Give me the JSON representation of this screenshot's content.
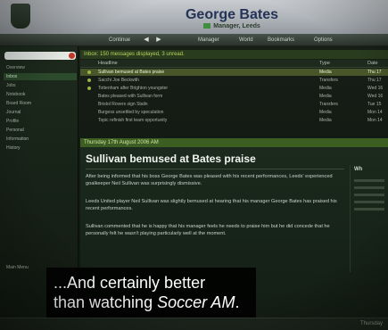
{
  "header": {
    "manager_name": "George Bates",
    "subtitle": "Manager, Leeds"
  },
  "toolbar": {
    "continue_label": "Continue",
    "manager_menu": "Manager",
    "world_menu": "World",
    "bookmarks_menu": "Bookmarks",
    "options_menu": "Options"
  },
  "sidebar": {
    "items": [
      {
        "label": "Overview"
      },
      {
        "label": "Inbox"
      },
      {
        "label": "Jobs"
      },
      {
        "label": "Notebook"
      },
      {
        "label": "Board Room"
      },
      {
        "label": "Journal"
      },
      {
        "label": "Profile"
      },
      {
        "label": "Personal"
      },
      {
        "label": "Information"
      },
      {
        "label": "History"
      }
    ],
    "bottom_label": "Main Menu"
  },
  "inbox": {
    "summary": "Inbox: 150 messages displayed, 3 unread.",
    "columns": [
      "Headline",
      "Type",
      "Date"
    ],
    "rows": [
      {
        "headline": "Sullivan bemused at Bates praise",
        "type": "Media",
        "date": "Thu 17"
      },
      {
        "headline": "Sacchi Joe Beckwith",
        "type": "Transfers",
        "date": "Thu 17"
      },
      {
        "headline": "Tottenham after Brighton youngster",
        "type": "Media",
        "date": "Wed 16"
      },
      {
        "headline": "Bates pleased with Sullivan form",
        "type": "Media",
        "date": "Wed 16"
      },
      {
        "headline": "Bristol Rovers sign Stalin",
        "type": "Transfers",
        "date": "Tue 15"
      },
      {
        "headline": "Burgess unsettled by speculation",
        "type": "Media",
        "date": "Mon 14"
      },
      {
        "headline": "Topic refinish first team opportunity",
        "type": "Media",
        "date": "Mon 14"
      }
    ]
  },
  "article": {
    "date_line": "Thursday 17th August 2006 AM",
    "title": "Sullivan bemused at Bates praise",
    "paragraphs": [
      "After being informed that his boss George Bates was pleased with his recent performances, Leeds' experienced goalkeeper Neil Sullivan was surprisingly dismissive.",
      "Leeds United player Neil Sullivan was slightly bemused at hearing that his manager George Bates has praised his recent performances.",
      "Sullivan commented that he is happy that his manager feels he needs to praise him but he did concede that he personally felt he wasn't playing particularly well at the moment."
    ],
    "side_title": "Wh"
  },
  "footer": {
    "label": "Thursday"
  },
  "caption": {
    "line1": "...And certainly better",
    "line2_prefix": "than watching ",
    "line2_italic": "Soccer AM",
    "line2_suffix": "."
  }
}
